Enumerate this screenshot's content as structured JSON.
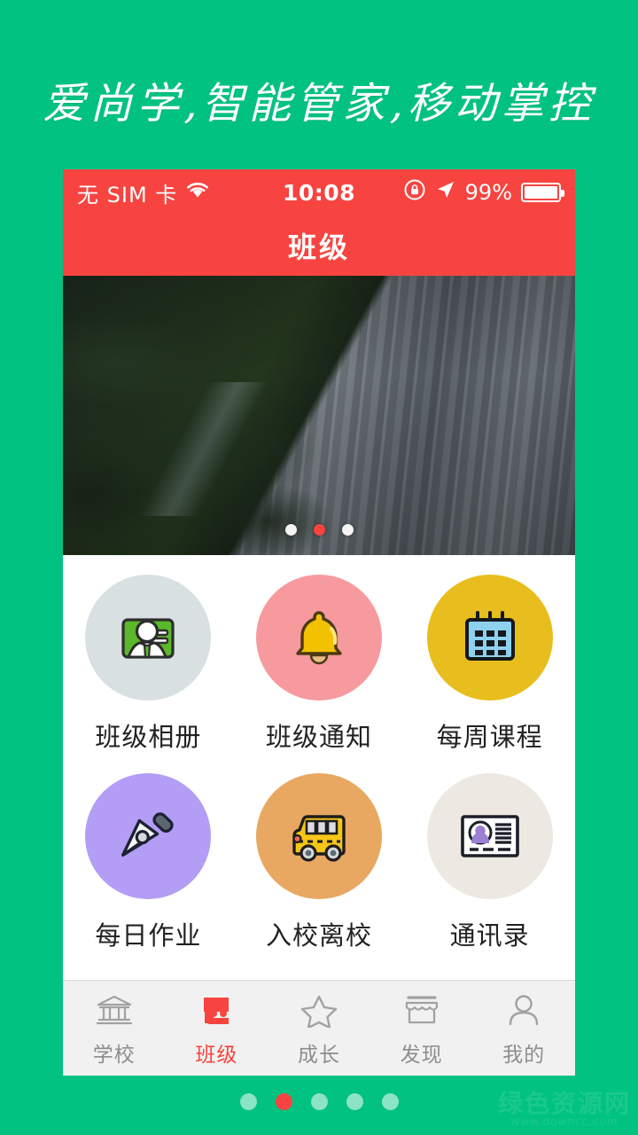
{
  "theme": {
    "background_green": "#01c281",
    "accent_red": "#f74440",
    "surface_white": "#ffffff",
    "tabbar_gray": "#f1f1f1"
  },
  "headline": {
    "text": "爱尚学,智能管家,移动掌控"
  },
  "phone": {
    "status_bar": {
      "carrier": "无 SIM 卡",
      "wifi_icon": "wifi-icon",
      "time": "10:08",
      "rotation_lock_icon": "rotation-lock-icon",
      "location_icon": "location-arrow-icon",
      "battery_percent": "99%",
      "battery_icon": "battery-icon"
    },
    "nav_bar": {
      "title": "班级"
    },
    "banner": {
      "image_description": "mountain-cliff-forest-photo",
      "dots": [
        {
          "active": false
        },
        {
          "active": true
        },
        {
          "active": false
        }
      ]
    },
    "grid": {
      "items": [
        {
          "label": "班级相册",
          "icon": "classroom-photo-icon",
          "circle_color": "#d8e0e2"
        },
        {
          "label": "班级通知",
          "icon": "bell-icon",
          "circle_color": "#f79a9e"
        },
        {
          "label": "每周课程",
          "icon": "calendar-icon",
          "circle_color": "#e8be1e"
        },
        {
          "label": "每日作业",
          "icon": "pen-nib-icon",
          "circle_color": "#b39df5"
        },
        {
          "label": "入校离校",
          "icon": "school-bus-icon",
          "circle_color": "#e8a861"
        },
        {
          "label": "通讯录",
          "icon": "id-card-icon",
          "circle_color": "#ede9e2"
        }
      ]
    },
    "tab_bar": {
      "tabs": [
        {
          "label": "学校",
          "icon": "school-building-icon",
          "active": false
        },
        {
          "label": "班级",
          "icon": "class-people-icon",
          "active": true
        },
        {
          "label": "成长",
          "icon": "star-icon",
          "active": false
        },
        {
          "label": "发现",
          "icon": "shop-icon",
          "active": false
        },
        {
          "label": "我的",
          "icon": "person-icon",
          "active": false
        }
      ]
    }
  },
  "page_indicator": {
    "dots": [
      {
        "active": false
      },
      {
        "active": true
      },
      {
        "active": false
      },
      {
        "active": false
      },
      {
        "active": false
      }
    ]
  },
  "watermark": {
    "main": "绿色资源网",
    "sub": "www.downcc.com"
  }
}
